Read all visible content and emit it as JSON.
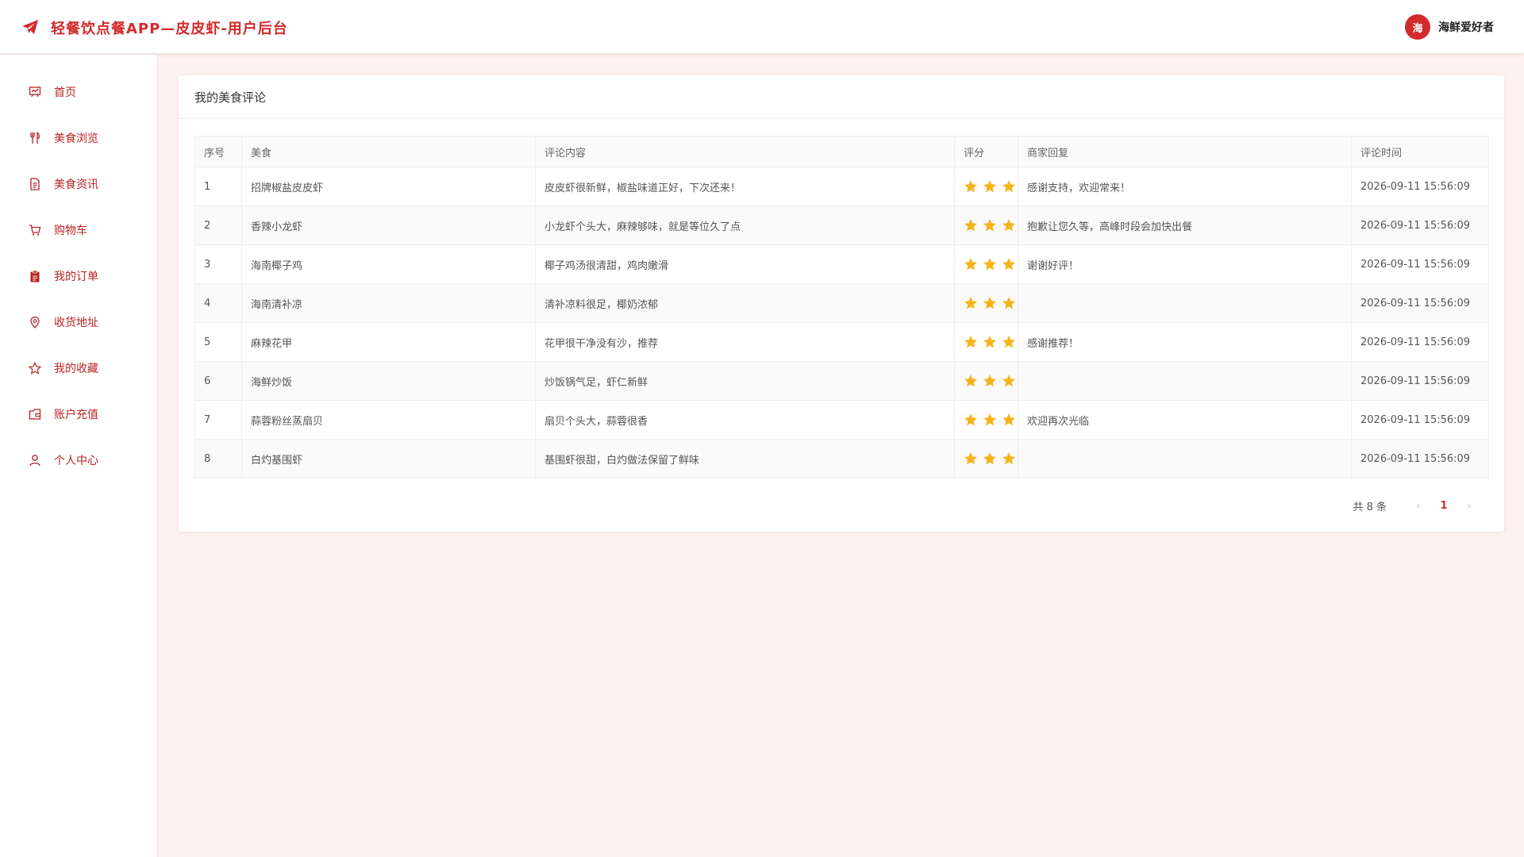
{
  "header": {
    "app_title": "轻餐饮点餐APP—皮皮虾-用户后台",
    "avatar_text": "海",
    "username": "海鲜爱好者",
    "accent_color": "#d22b2b"
  },
  "sidebar": {
    "items": [
      {
        "label": "首页",
        "icon": "home-board-icon"
      },
      {
        "label": "美食浏览",
        "icon": "fork-knife-icon"
      },
      {
        "label": "美食资讯",
        "icon": "document-icon"
      },
      {
        "label": "购物车",
        "icon": "cart-icon"
      },
      {
        "label": "我的订单",
        "icon": "clipboard-icon"
      },
      {
        "label": "收货地址",
        "icon": "location-pin-icon"
      },
      {
        "label": "我的收藏",
        "icon": "star-outline-icon"
      },
      {
        "label": "账户充值",
        "icon": "wallet-icon"
      },
      {
        "label": "个人中心",
        "icon": "user-icon"
      }
    ]
  },
  "main": {
    "card_title": "我的美食评论",
    "columns": [
      "序号",
      "美食",
      "评论内容",
      "评分",
      "商家回复",
      "评论时间"
    ],
    "rows": [
      {
        "no": "1",
        "food": "招牌椒盐皮皮虾",
        "comment": "皮皮虾很新鲜，椒盐味道正好，下次还来！",
        "rating": 3,
        "reply": "感谢支持，欢迎常来！",
        "time": "2026-09-11 15:56:09"
      },
      {
        "no": "2",
        "food": "香辣小龙虾",
        "comment": "小龙虾个头大，麻辣够味，就是等位久了点",
        "rating": 3,
        "reply": "抱歉让您久等，高峰时段会加快出餐",
        "time": "2026-09-11 15:56:09"
      },
      {
        "no": "3",
        "food": "海南椰子鸡",
        "comment": "椰子鸡汤很清甜，鸡肉嫩滑",
        "rating": 3,
        "reply": "谢谢好评！",
        "time": "2026-09-11 15:56:09"
      },
      {
        "no": "4",
        "food": "海南清补凉",
        "comment": "清补凉料很足，椰奶浓郁",
        "rating": 3,
        "reply": "",
        "time": "2026-09-11 15:56:09"
      },
      {
        "no": "5",
        "food": "麻辣花甲",
        "comment": "花甲很干净没有沙，推荐",
        "rating": 3,
        "reply": "感谢推荐！",
        "time": "2026-09-11 15:56:09"
      },
      {
        "no": "6",
        "food": "海鲜炒饭",
        "comment": "炒饭锅气足，虾仁新鲜",
        "rating": 3,
        "reply": "",
        "time": "2026-09-11 15:56:09"
      },
      {
        "no": "7",
        "food": "蒜蓉粉丝蒸扇贝",
        "comment": "扇贝个头大，蒜蓉很香",
        "rating": 3,
        "reply": "欢迎再次光临",
        "time": "2026-09-11 15:56:09"
      },
      {
        "no": "8",
        "food": "白灼基围虾",
        "comment": "基围虾很甜，白灼做法保留了鲜味",
        "rating": 3,
        "reply": "",
        "time": "2026-09-11 15:56:09"
      }
    ],
    "star_color": "#f5b41c"
  },
  "pagination": {
    "total_text": "共 8 条",
    "prev": "‹",
    "current_page": "1",
    "next": "›"
  }
}
